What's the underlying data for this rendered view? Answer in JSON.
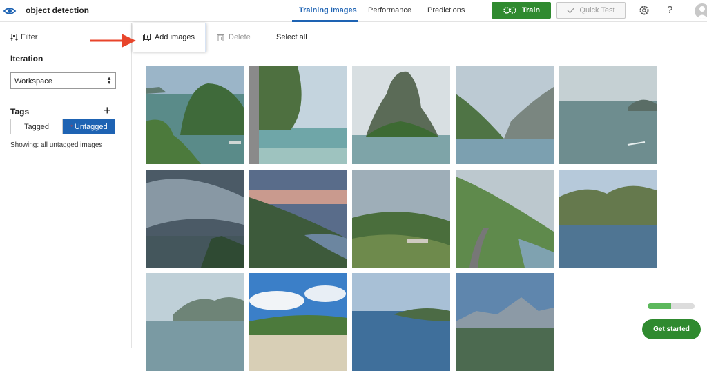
{
  "app": {
    "project_name": "object detection",
    "tabs": [
      {
        "label": "Training Images",
        "active": true
      },
      {
        "label": "Performance",
        "active": false
      },
      {
        "label": "Predictions",
        "active": false
      }
    ],
    "train_label": "Train",
    "quick_test_label": "Quick Test",
    "help_label": "?",
    "accent_color": "#1e63b3",
    "train_color": "#2f8a2f"
  },
  "sidebar": {
    "filter_label": "Filter",
    "iteration_heading": "Iteration",
    "iteration_select_value": "Workspace",
    "tags_heading": "Tags",
    "tag_segments": {
      "tagged": "Tagged",
      "untagged": "Untagged"
    },
    "showing_text": "Showing: all untagged images"
  },
  "toolbar": {
    "add_images_label": "Add images",
    "delete_label": "Delete",
    "select_all_label": "Select all"
  },
  "images": {
    "count": 14,
    "items": [
      {
        "scene": "karst-island-bay"
      },
      {
        "scene": "cliff-beach"
      },
      {
        "scene": "limestone-peak"
      },
      {
        "scene": "fjord-valley"
      },
      {
        "scene": "misty-sea-islands"
      },
      {
        "scene": "stormy-coast"
      },
      {
        "scene": "sunset-hills"
      },
      {
        "scene": "sunrays-farmland"
      },
      {
        "scene": "coastal-road"
      },
      {
        "scene": "mountain-lake"
      },
      {
        "scene": "hazy-coastline"
      },
      {
        "scene": "cloudy-beach"
      },
      {
        "scene": "island-blue-sea"
      },
      {
        "scene": "distant-mountains"
      }
    ]
  },
  "onboarding": {
    "progress_fraction": 0.5,
    "get_started_label": "Get started"
  }
}
